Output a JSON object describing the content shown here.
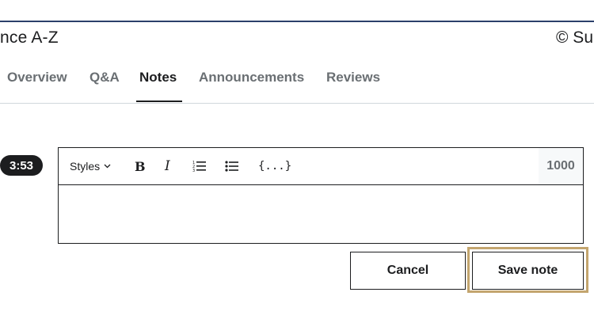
{
  "header": {
    "course_title": "nce A-Z",
    "copyright": "© Su"
  },
  "tabs": [
    {
      "label": "Overview",
      "active": false
    },
    {
      "label": "Q&A",
      "active": false
    },
    {
      "label": "Notes",
      "active": true
    },
    {
      "label": "Announcements",
      "active": false
    },
    {
      "label": "Reviews",
      "active": false
    }
  ],
  "note": {
    "timestamp": "3:53",
    "styles_label": "Styles",
    "code_label": "{...}",
    "char_remaining": "1000",
    "body_value": ""
  },
  "actions": {
    "cancel_label": "Cancel",
    "save_label": "Save note"
  },
  "colors": {
    "top_rule": "#2b3f6b",
    "focus_ring": "#c3a56e",
    "text": "#1c1d1f",
    "muted": "#6a6f73"
  },
  "icons": [
    "chevron-down-icon",
    "bold-icon",
    "italic-icon",
    "ordered-list-icon",
    "bulleted-list-icon",
    "code-icon"
  ]
}
